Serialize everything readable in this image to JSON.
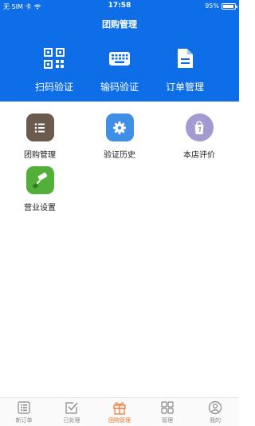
{
  "status_bar": {
    "carrier": "无 SIM 卡",
    "time": "17:58",
    "battery": "95%",
    "battery_level": 0.95
  },
  "nav": {
    "title": "团购管理"
  },
  "quick_actions": [
    {
      "label": "扫码验证",
      "icon": "qr-code-icon"
    },
    {
      "label": "输码验证",
      "icon": "keyboard-icon"
    },
    {
      "label": "订单管理",
      "icon": "document-icon"
    }
  ],
  "grid": [
    {
      "label": "团购管理",
      "icon": "list-icon",
      "color": "#6b5a4e"
    },
    {
      "label": "验证历史",
      "icon": "gear-icon",
      "color": "#3f8fe6"
    },
    {
      "label": "本店评价",
      "icon": "shopping-bag-icon",
      "color": "#a49ad2"
    },
    {
      "label": "营业设置",
      "icon": "paint-roller-icon",
      "color": "#52b03a"
    }
  ],
  "tabbar": {
    "active_color": "#e8762a",
    "items": [
      {
        "label": "新订单",
        "icon": "list-icon"
      },
      {
        "label": "已处理",
        "icon": "checkbox-icon"
      },
      {
        "label": "团购管理",
        "icon": "gift-icon"
      },
      {
        "label": "管理",
        "icon": "grid-icon"
      },
      {
        "label": "我的",
        "icon": "user-icon"
      }
    ]
  }
}
